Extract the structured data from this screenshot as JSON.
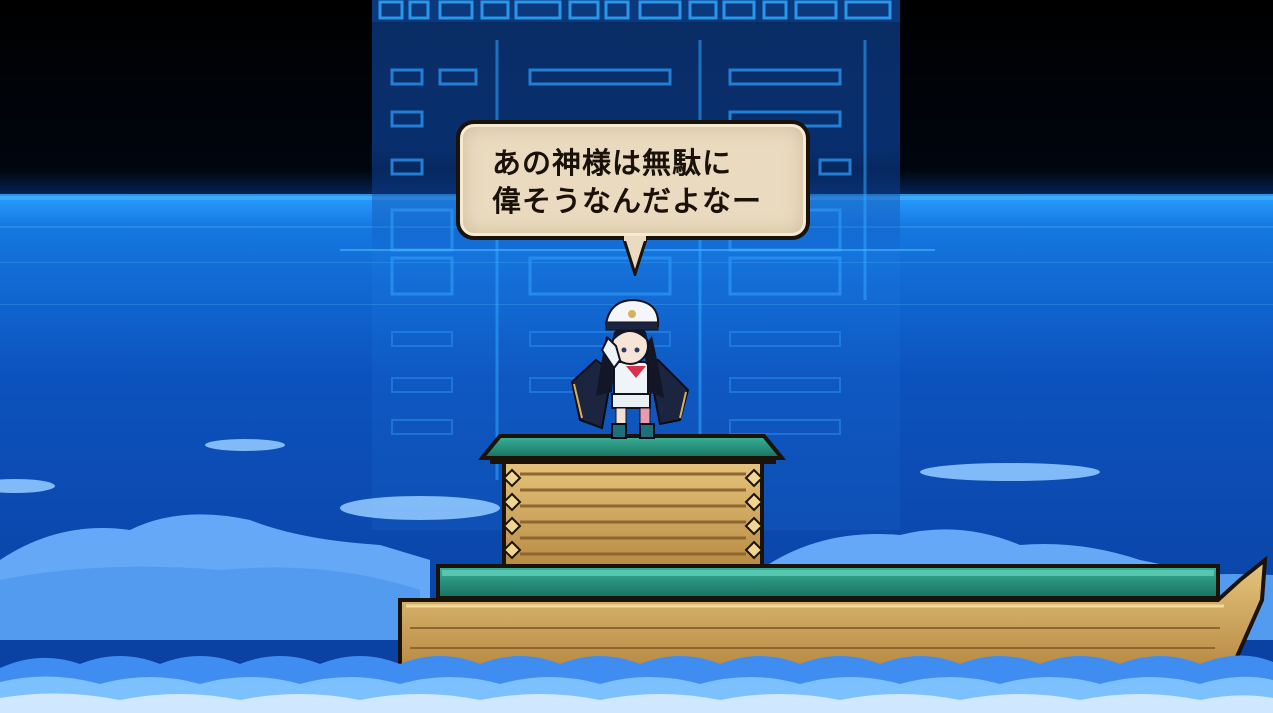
{
  "dialogue": {
    "lines": [
      "あの神様は無駄に",
      "偉そうなんだよなー"
    ]
  },
  "colors": {
    "sky": "#000000",
    "sea_horizon": "#1f8cf0",
    "sea_deep": "#0b3fa6",
    "hologram": "#2ea8ff",
    "bubble_fill": "#eadbc0",
    "boat_wood": "#d9b56a",
    "boat_roof": "#1f8a78"
  },
  "icons": {
    "character": "captain-girl-sprite",
    "platform": "wooden-boat"
  }
}
